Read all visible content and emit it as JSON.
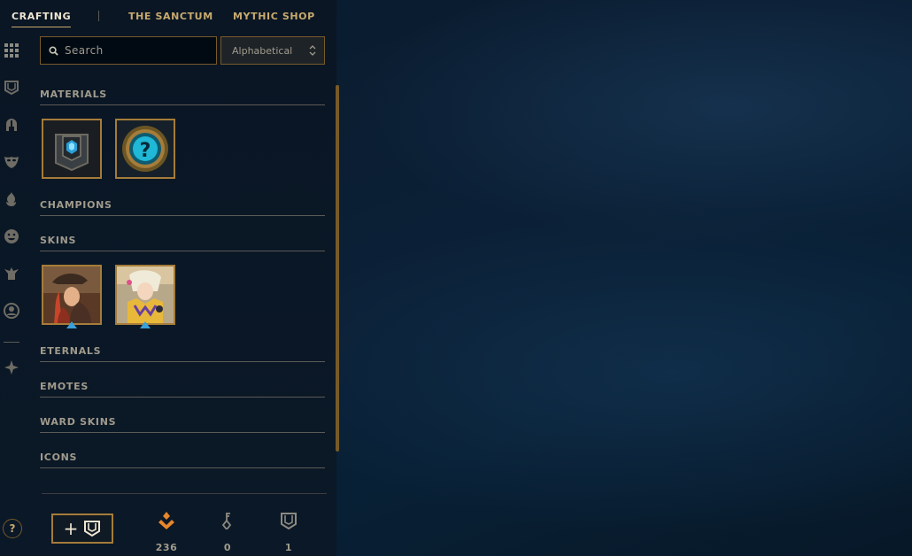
{
  "tabs": [
    {
      "label": "CRAFTING",
      "active": true
    },
    {
      "label": "THE SANCTUM",
      "active": false
    },
    {
      "label": "MYTHIC SHOP",
      "active": false
    }
  ],
  "rail_icons": [
    "grid-icon",
    "chest-icon",
    "champion-helmet-icon",
    "skin-mask-icon",
    "ward-flame-icon",
    "emote-face-icon",
    "eternals-icon",
    "profile-icon-icon",
    "crafting-forge-icon"
  ],
  "search": {
    "placeholder": "Search",
    "value": ""
  },
  "sort": {
    "selected": "Alphabetical"
  },
  "sections": [
    {
      "title": "MATERIALS",
      "items": [
        "hextech-chest-item",
        "mystery-item"
      ]
    },
    {
      "title": "CHAMPIONS",
      "items": []
    },
    {
      "title": "SKINS",
      "items": [
        "skin-shard-1",
        "skin-shard-2"
      ]
    },
    {
      "title": "ETERNALS",
      "items": []
    },
    {
      "title": "EMOTES",
      "items": []
    },
    {
      "title": "WARD SKINS",
      "items": []
    },
    {
      "title": "ICONS",
      "items": []
    }
  ],
  "bottom": {
    "help": "?",
    "add_plus": "+",
    "currencies": [
      {
        "name": "orange-essence",
        "value": "236"
      },
      {
        "name": "key",
        "value": "0"
      },
      {
        "name": "chest",
        "value": "1"
      }
    ]
  },
  "colors": {
    "gold": "#c8aa6e",
    "gold_dark": "#785a28",
    "text_muted": "#a09b8c",
    "orange_essence": "#e8862a",
    "tile_border": "#a57c3a",
    "badge_blue": "#3aa0d8"
  }
}
